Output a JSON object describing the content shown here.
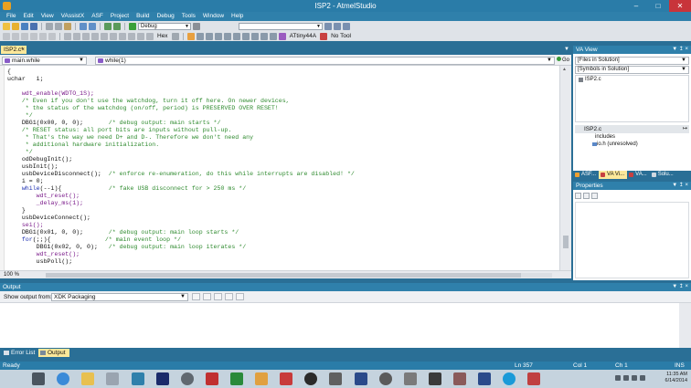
{
  "window": {
    "title": "ISP2 - AtmelStudio"
  },
  "menu": [
    "File",
    "Edit",
    "View",
    "VAssistX",
    "ASF",
    "Project",
    "Build",
    "Debug",
    "Tools",
    "Window",
    "Help"
  ],
  "toolbar": {
    "config": "Debug",
    "hex_label": "Hex",
    "device": "ATtiny44A",
    "tool": "No Tool"
  },
  "editor": {
    "tab_label": "ISP2.c*",
    "scope_combo": "main.while",
    "function_combo": "while(1)",
    "go_label": "Go",
    "zoom": "100 %",
    "lines": [
      [
        [
          "{",
          "plain"
        ]
      ],
      [
        [
          "uchar   i;",
          "plain"
        ]
      ],
      [
        [
          "",
          "plain"
        ]
      ],
      [
        [
          "    wdt_enable(WDTO_1S);",
          "ident"
        ]
      ],
      [
        [
          "    /* Even if you don't use the watchdog, turn it off here. On newer devices,",
          "com"
        ]
      ],
      [
        [
          "     * the status of the watchdog (on/off, period) is PRESERVED OVER RESET!",
          "com"
        ]
      ],
      [
        [
          "     */",
          "com"
        ]
      ],
      [
        [
          "    DBG1(0x00, 0, 0);       ",
          "plain"
        ],
        [
          "/* debug output: main starts */",
          "com"
        ]
      ],
      [
        [
          "    /* RESET status: all port bits are inputs without pull-up.",
          "com"
        ]
      ],
      [
        [
          "     * That's the way we need D+ and D-. Therefore we don't need any",
          "com"
        ]
      ],
      [
        [
          "     * additional hardware initialization.",
          "com"
        ]
      ],
      [
        [
          "     */",
          "com"
        ]
      ],
      [
        [
          "    odDebugInit();",
          "plain"
        ]
      ],
      [
        [
          "    usbInit();",
          "plain"
        ]
      ],
      [
        [
          "    usbDeviceDisconnect();  ",
          "plain"
        ],
        [
          "/* enforce re-enumeration, do this while interrupts are disabled! */",
          "com"
        ]
      ],
      [
        [
          "    i = 0;",
          "plain"
        ]
      ],
      [
        [
          "    while",
          "kw"
        ],
        [
          "(--i){             ",
          "plain"
        ],
        [
          "/* fake USB disconnect for > 250 ms */",
          "com"
        ]
      ],
      [
        [
          "        wdt_reset();",
          "ident"
        ]
      ],
      [
        [
          "        _delay_ms(1);",
          "ident"
        ]
      ],
      [
        [
          "    }",
          "plain"
        ]
      ],
      [
        [
          "    usbDeviceConnect();",
          "plain"
        ]
      ],
      [
        [
          "    sei();",
          "ident"
        ]
      ],
      [
        [
          "    DBG1(0x01, 0, 0);       ",
          "plain"
        ],
        [
          "/* debug output: main loop starts */",
          "com"
        ]
      ],
      [
        [
          "    for",
          "kw"
        ],
        [
          "(;;){               ",
          "plain"
        ],
        [
          "/* main event loop */",
          "com"
        ]
      ],
      [
        [
          "        DBG1(0x02, 0, 0);   ",
          "plain"
        ],
        [
          "/* debug output: main loop iterates */",
          "com"
        ]
      ],
      [
        [
          "        wdt_reset();",
          "ident"
        ]
      ],
      [
        [
          "        usbPoll();",
          "plain"
        ]
      ]
    ]
  },
  "va_view": {
    "title": "VA View",
    "combo1": "[Files in Solution]",
    "combo2": "[Symbols in Solution]",
    "files": [
      "ISP2.c"
    ],
    "sub_title": "ISP2.c",
    "tree": [
      {
        "label": "includes",
        "child": false
      },
      {
        "label": "io.h (unresolved)",
        "child": true
      }
    ],
    "tabs": [
      "ASF...",
      "VA Vi...",
      "VA...",
      "Solu..."
    ]
  },
  "properties": {
    "title": "Properties"
  },
  "output": {
    "title": "Output",
    "show_from_label": "Show output from:",
    "source": "XDK Packaging"
  },
  "bottom_tabs": [
    "Error List",
    "Output"
  ],
  "status": {
    "left": "Ready",
    "ln": "Ln 357",
    "col": "Col 1",
    "ch": "Ch 1",
    "mode": "INS"
  },
  "taskbar": {
    "time": "11:35 AM",
    "date": "6/14/2014"
  },
  "colors": {
    "accent": "#2a7ca8",
    "tab_active": "#fce89a",
    "comment": "#2e8a2e",
    "keyword": "#1a2db0"
  }
}
